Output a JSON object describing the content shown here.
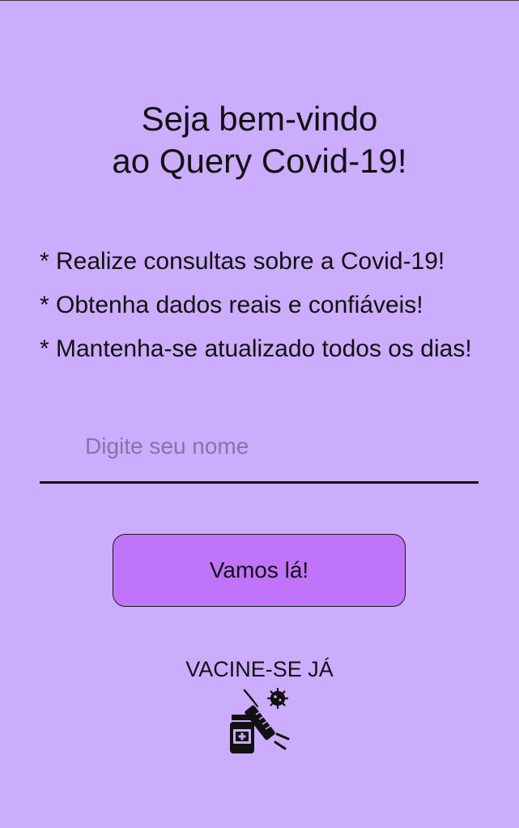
{
  "welcome": {
    "title_line1": "Seja bem-vindo",
    "title_line2": "ao Query Covid-19!"
  },
  "features": [
    "* Realize consultas sobre a Covid-19!",
    "* Obtenha dados reais e confiáveis!",
    "* Mantenha-se atualizado todos os dias!"
  ],
  "name_input": {
    "placeholder": "Digite seu nome",
    "value": ""
  },
  "submit_button": {
    "label": "Vamos lá!"
  },
  "vaccine_banner": {
    "label": "VACINE-SE JÁ",
    "icon": "vaccine-syringe-virus-icon"
  },
  "colors": {
    "background": "#ccacfd",
    "button": "#bf74fa",
    "text": "#111111",
    "placeholder": "#8a72a8"
  }
}
